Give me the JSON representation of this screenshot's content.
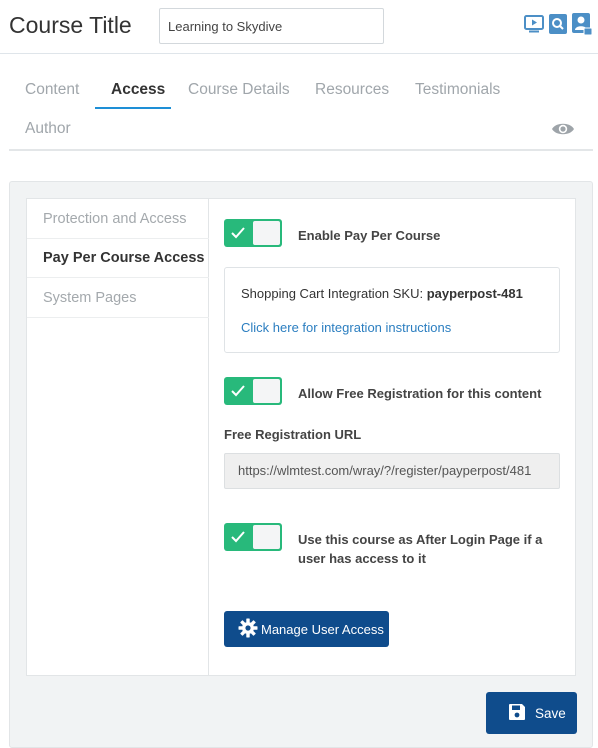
{
  "header": {
    "title": "Course Title",
    "course_name_value": "Learning to Skydive",
    "icons": [
      "video-icon",
      "search-icon",
      "user-icon"
    ]
  },
  "tabs": {
    "items": [
      {
        "label": "Content",
        "active": false
      },
      {
        "label": "Access",
        "active": true
      },
      {
        "label": "Course Details",
        "active": false
      },
      {
        "label": "Resources",
        "active": false
      },
      {
        "label": "Testimonials",
        "active": false
      },
      {
        "label": "Author",
        "active": false
      }
    ],
    "preview_icon": "eye-icon"
  },
  "sidebar": {
    "items": [
      {
        "label": "Protection and Access",
        "active": false
      },
      {
        "label": "Pay Per Course Access",
        "active": true
      },
      {
        "label": "System Pages",
        "active": false
      }
    ]
  },
  "settings": {
    "enable_ppc": {
      "label": "Enable Pay Per Course",
      "on": true
    },
    "sku_label": "Shopping Cart Integration SKU:",
    "sku_value": "payperpost-481",
    "integration_link": "Click here for integration instructions",
    "free_reg": {
      "label": "Allow Free Registration for this content",
      "on": true
    },
    "free_reg_url_label": "Free Registration URL",
    "free_reg_url": "https://wlmtest.com/wray/?/register/payperpost/481",
    "after_login": {
      "label_line1": "Use this course as After Login Page if a",
      "label_line2": "user has access to it",
      "on": true
    },
    "manage_button": "Manage User Access"
  },
  "footer": {
    "save_button": "Save"
  },
  "colors": {
    "accent": "#1e8fd6",
    "toggle_on": "#28b97b",
    "primary_button": "#0f4c8c",
    "link": "#2b7ec0",
    "header_icons": "#4c8fc6"
  }
}
